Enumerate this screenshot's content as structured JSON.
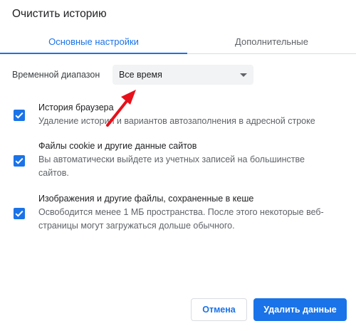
{
  "dialog": {
    "title": "Очистить историю"
  },
  "tabs": [
    {
      "label": "Основные настройки",
      "active": true
    },
    {
      "label": "Дополнительные",
      "active": false
    }
  ],
  "time_range": {
    "label": "Временной диапазон",
    "selected": "Все время"
  },
  "options": [
    {
      "title": "История браузера",
      "description": "Удаление истории и вариантов автозаполнения в адресной строке",
      "checked": true
    },
    {
      "title": "Файлы cookie и другие данные сайтов",
      "description": "Вы автоматически выйдете из учетных записей на большинстве сайтов.",
      "checked": true
    },
    {
      "title": "Изображения и другие файлы, сохраненные в кеше",
      "description": "Освободится менее 1 МБ пространства. После этого некоторые веб-страницы могут загружаться дольше обычного.",
      "checked": true
    }
  ],
  "buttons": {
    "cancel": "Отмена",
    "delete": "Удалить данные"
  },
  "colors": {
    "accent": "#1a73e8",
    "annotation_arrow": "#e8101a"
  },
  "icons": {
    "checkbox": "check-icon",
    "dropdown": "caret-down-icon",
    "annotation": "red-arrow-icon"
  }
}
